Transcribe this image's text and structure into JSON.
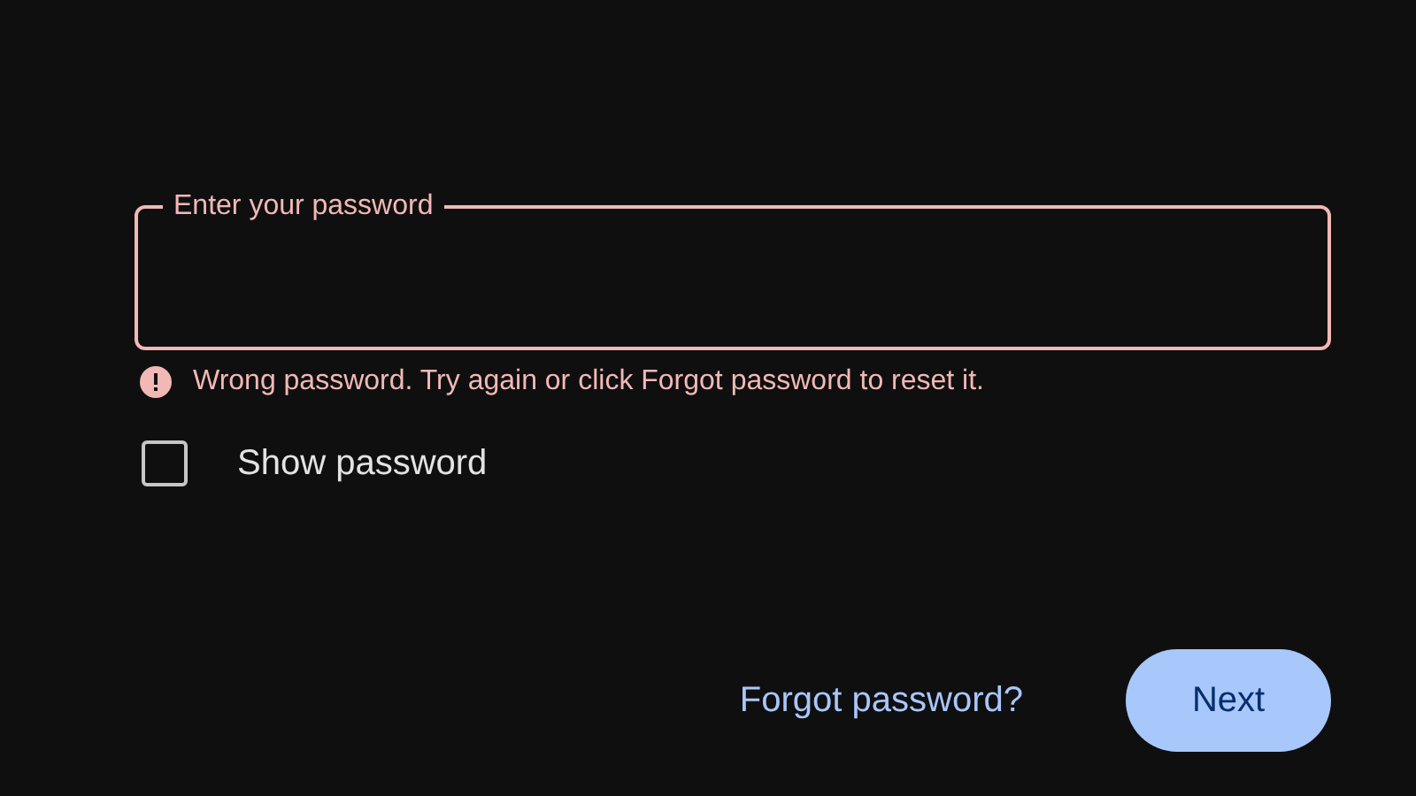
{
  "password_field": {
    "label": "Enter your password",
    "error": true
  },
  "error_message": "Wrong password. Try again or click Forgot password to reset it.",
  "show_password": {
    "label": "Show password",
    "checked": false
  },
  "forgot_link": "Forgot password?",
  "next_button": "Next"
}
